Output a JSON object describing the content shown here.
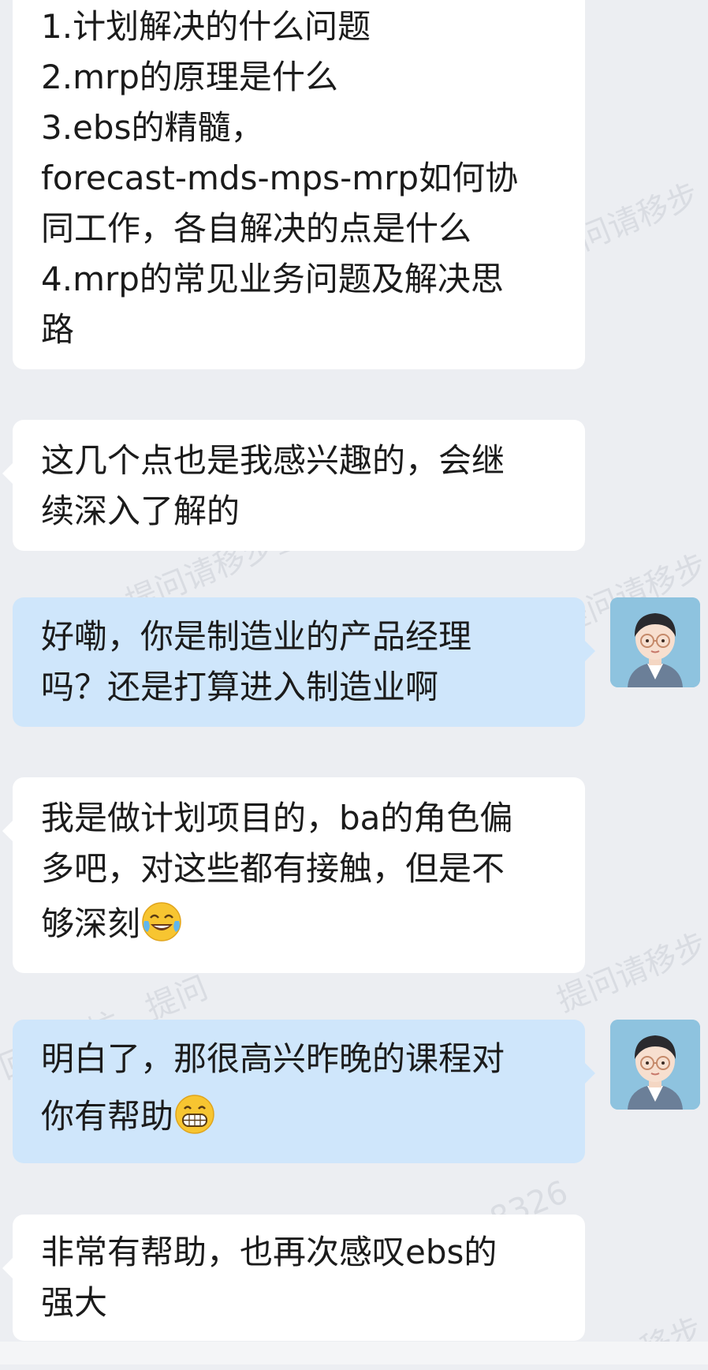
{
  "messages": [
    {
      "side": "in",
      "lines": [
        "1.计划解决的什么问题",
        "2.mrp的原理是什么",
        "3.ebs的精髓，",
        "forecast-mds-mps-mrp如何协",
        "同工作，各自解决的点是什么",
        "4.mrp的常见业务问题及解决思",
        "路"
      ]
    },
    {
      "side": "in",
      "lines": [
        "这几个点也是我感兴趣的，会继",
        "续深入了解的"
      ]
    },
    {
      "side": "out",
      "lines": [
        "好嘞，你是制造业的产品经理",
        "吗？还是打算进入制造业啊"
      ]
    },
    {
      "side": "in",
      "lines": [
        "我是做计划项目的，ba的角色偏",
        "多吧，对这些都有接触，但是不",
        "够深刻"
      ],
      "emoji": "tears-of-joy-emoji"
    },
    {
      "side": "out",
      "lines": [
        "明白了，那很高兴昨晚的课程对",
        "你有帮助"
      ],
      "emoji": "grin-emoji"
    },
    {
      "side": "in",
      "lines": [
        "非常有帮助，也再次感叹ebs的",
        "强大"
      ]
    }
  ],
  "watermarks": [
    "提问请移步",
    "提问请移步星球",
    "提问请移步",
    "回数很忙，提问",
    "提问请移步",
    "8326",
    "移步"
  ],
  "colors": {
    "incoming_bubble": "#ffffff",
    "outgoing_bubble": "#cfe6fb",
    "background": "#eceef2"
  }
}
